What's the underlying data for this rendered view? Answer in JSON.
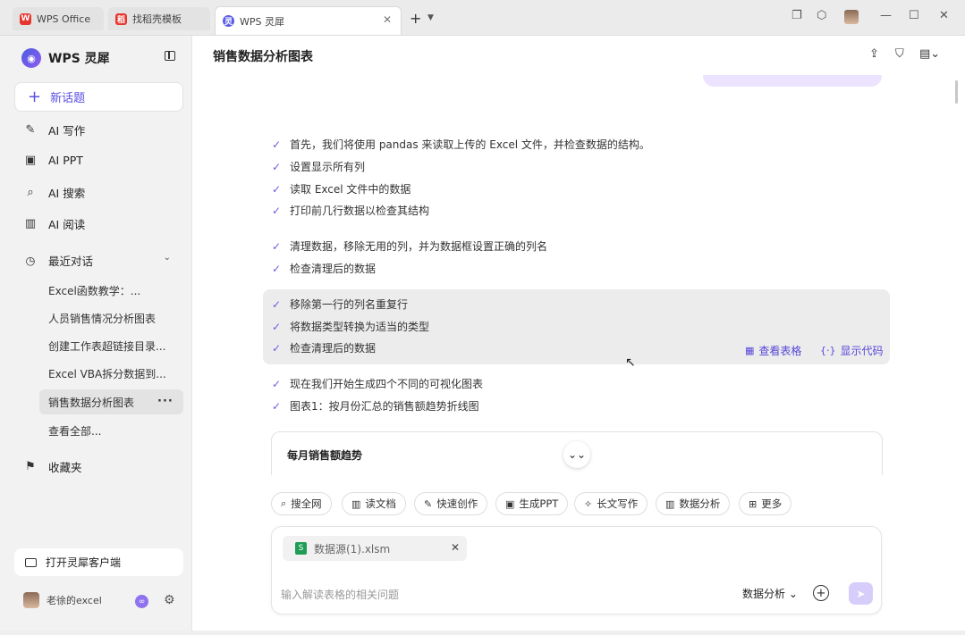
{
  "titlebar": {
    "tabs": [
      {
        "label": "WPS Office",
        "icon": "wps-office-icon",
        "color": "#e8342f"
      },
      {
        "label": "找稻壳模板",
        "icon": "docer-icon",
        "color": "#e8342f"
      },
      {
        "label": "WPS 灵犀",
        "icon": "lingxi-icon",
        "color": "#5b5ee8"
      }
    ],
    "new_tab": "+",
    "new_tab_menu": "⌄"
  },
  "sidebar": {
    "brand": "WPS 灵犀",
    "new_topic": "新话题",
    "nav": [
      {
        "label": "AI 写作",
        "icon": "pen-icon"
      },
      {
        "label": "AI PPT",
        "icon": "presentation-icon"
      },
      {
        "label": "AI 搜索",
        "icon": "search-icon"
      },
      {
        "label": "AI 阅读",
        "icon": "book-icon"
      }
    ],
    "recent_label": "最近对话",
    "history": [
      "Excel函数教学：...",
      "人员销售情况分析图表",
      "创建工作表超链接目录...",
      "Excel VBA拆分数据到...",
      "销售数据分析图表",
      "查看全部..."
    ],
    "favorites": "收藏夹",
    "open_client": "打开灵犀客户端",
    "user_name": "老徐的excel"
  },
  "main": {
    "title": "销售数据分析图表",
    "steps_a": [
      "首先，我们将使用 pandas 来读取上传的 Excel 文件，并检查数据的结构。",
      "设置显示所有列",
      "读取 Excel 文件中的数据",
      "打印前几行数据以检查其结构"
    ],
    "steps_b": [
      "清理数据，移除无用的列，并为数据框设置正确的列名",
      "检查清理后的数据"
    ],
    "steps_c": [
      "移除第一行的列名重复行",
      "将数据类型转换为适当的类型",
      "检查清理后的数据"
    ],
    "view_table": "查看表格",
    "show_code": "显示代码",
    "steps_d": [
      "现在我们开始生成四个不同的可视化图表",
      "图表1：按月份汇总的销售额趋势折线图"
    ],
    "chart_card_title": "每月销售额趋势",
    "chips": [
      {
        "label": "搜全网",
        "icon": "search-web-icon"
      },
      {
        "label": "读文档",
        "icon": "read-doc-icon"
      },
      {
        "label": "快速创作",
        "icon": "quick-create-icon"
      },
      {
        "label": "生成PPT",
        "icon": "ppt-icon"
      },
      {
        "label": "长文写作",
        "icon": "long-write-icon"
      },
      {
        "label": "数据分析",
        "icon": "data-analysis-icon"
      },
      {
        "label": "更多",
        "icon": "more-grid-icon"
      }
    ],
    "attachment": "数据源(1).xlsm",
    "input_placeholder": "输入解读表格的相关问题",
    "mode": "数据分析"
  },
  "colors": {
    "accent": "#5b4fe0",
    "check": "#6a5ae6",
    "send_disabled": "#d7cdfb",
    "excel_green": "#1f9d55"
  }
}
